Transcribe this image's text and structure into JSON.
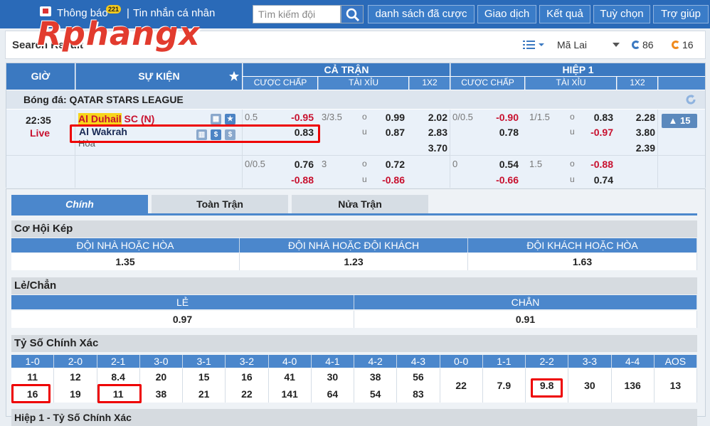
{
  "topbar": {
    "notifications": "Thông báo",
    "notif_count": "221",
    "messages": "Tin nhắn cá nhân",
    "search_placeholder": "Tìm kiếm đội",
    "nav": [
      "danh sách đã cược",
      "Giao dịch",
      "Kết quả",
      "Tuỳ chọn",
      "Trợ giúp"
    ]
  },
  "logo": "Rphangx",
  "resbar": {
    "title": "Search Result",
    "odds_type": "Mã Lai",
    "count_a": "86",
    "count_b": "16"
  },
  "odds": {
    "headers": {
      "time": "GIỜ",
      "event": "SỰ KIỆN",
      "full": "CẢ TRẬN",
      "half": "HIỆP 1",
      "sub": [
        "CƯỢC CHẤP",
        "TÀI XỈU",
        "1X2",
        "CƯỢC CHẤP",
        "TÀI XỈU",
        "1X2"
      ]
    },
    "league": "Bóng đá: QATAR STARS LEAGUE",
    "match": {
      "time": "22:35",
      "status": "Live",
      "home_hl": "Al Duhail",
      "home_rest": " SC (N)",
      "away": "Al Wakrah",
      "draw": "Hòa",
      "more": "▲ 15"
    },
    "row1": {
      "ah_line": "0.5",
      "ah_home": "-0.95",
      "ah_away": "0.83",
      "ou_line": "3/3.5",
      "ou_o": "o",
      "ou_u": "u",
      "ou_over": "0.99",
      "ou_under": "0.87",
      "x1": "2.02",
      "x2": "2.83",
      "xd": "3.70",
      "h_ah_line": "0/0.5",
      "h_ah_home": "-0.90",
      "h_ah_away": "0.78",
      "h_ou_line": "1/1.5",
      "h_ou_over": "0.83",
      "h_ou_under": "-0.97",
      "h_x1": "2.28",
      "h_x2": "3.80",
      "h_xd": "2.39"
    },
    "row2": {
      "ah_line": "0/0.5",
      "ah_home": "0.76",
      "ah_away": "-0.88",
      "ou_line": "3",
      "ou_over": "0.72",
      "ou_under": "-0.86",
      "h_ah_line": "0",
      "h_ah_home": "0.54",
      "h_ah_away": "-0.66",
      "h_ou_line": "1.5",
      "h_ou_over": "-0.88",
      "h_ou_under": "0.74"
    }
  },
  "details": {
    "tabs": [
      "Chính",
      "Toàn Trận",
      "Nửa Trận"
    ],
    "double_chance": {
      "title": "Cơ Hội Kép",
      "cols": [
        "ĐỘI NHÀ HOẶC HÒA",
        "ĐỘI NHÀ HOẶC ĐỘI KHÁCH",
        "ĐỘI KHÁCH HOẶC HÒA"
      ],
      "vals": [
        "1.35",
        "1.23",
        "1.63"
      ]
    },
    "odd_even": {
      "title": "Lẻ/Chẳn",
      "cols": [
        "LẺ",
        "CHẲN"
      ],
      "vals": [
        "0.97",
        "0.91"
      ]
    },
    "correct_score": {
      "title": "Tỷ Số Chính Xác",
      "cols": [
        "1-0",
        "2-0",
        "2-1",
        "3-0",
        "3-1",
        "3-2",
        "4-0",
        "4-1",
        "4-2",
        "4-3",
        "0-0",
        "1-1",
        "2-2",
        "3-3",
        "4-4",
        "AOS"
      ],
      "home": [
        "11",
        "12",
        "8.4",
        "20",
        "15",
        "16",
        "41",
        "30",
        "38",
        "56"
      ],
      "away": [
        "16",
        "19",
        "11",
        "38",
        "21",
        "22",
        "141",
        "64",
        "54",
        "83"
      ],
      "draw": [
        "22",
        "7.9",
        "9.8",
        "30",
        "136",
        "13"
      ]
    },
    "next_title": "Hiệp 1 - Tỷ Số Chính Xác"
  }
}
